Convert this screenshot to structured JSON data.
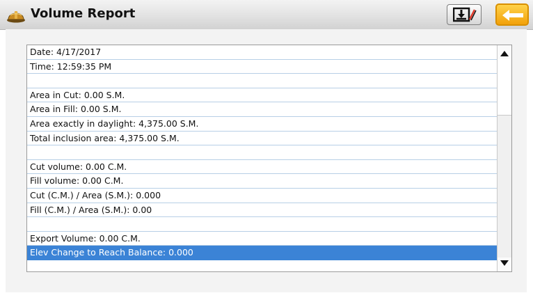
{
  "header": {
    "title": "Volume Report",
    "app_icon": "hard-hat-icon",
    "export_icon": "export-report-icon",
    "back_icon": "back-arrow-icon",
    "accent_color": "#f2a10a"
  },
  "report": {
    "rows": [
      {
        "text": "Date: 4/17/2017"
      },
      {
        "text": "Time: 12:59:35 PM"
      },
      {
        "text": ""
      },
      {
        "text": "Area in Cut: 0.00 S.M."
      },
      {
        "text": "Area in Fill: 0.00 S.M."
      },
      {
        "text": "Area exactly in daylight: 4,375.00 S.M."
      },
      {
        "text": "Total inclusion area: 4,375.00 S.M."
      },
      {
        "text": ""
      },
      {
        "text": "Cut  volume: 0.00 C.M."
      },
      {
        "text": "Fill volume: 0.00 C.M."
      },
      {
        "text": "Cut (C.M.) / Area (S.M.): 0.000"
      },
      {
        "text": "Fill (C.M.) / Area (S.M.): 0.00"
      },
      {
        "text": ""
      },
      {
        "text": "Export Volume: 0.00 C.M."
      },
      {
        "text": "Elev Change to Reach Balance: 0.000",
        "selected": true
      }
    ],
    "selection_color": "#3b83d6"
  }
}
